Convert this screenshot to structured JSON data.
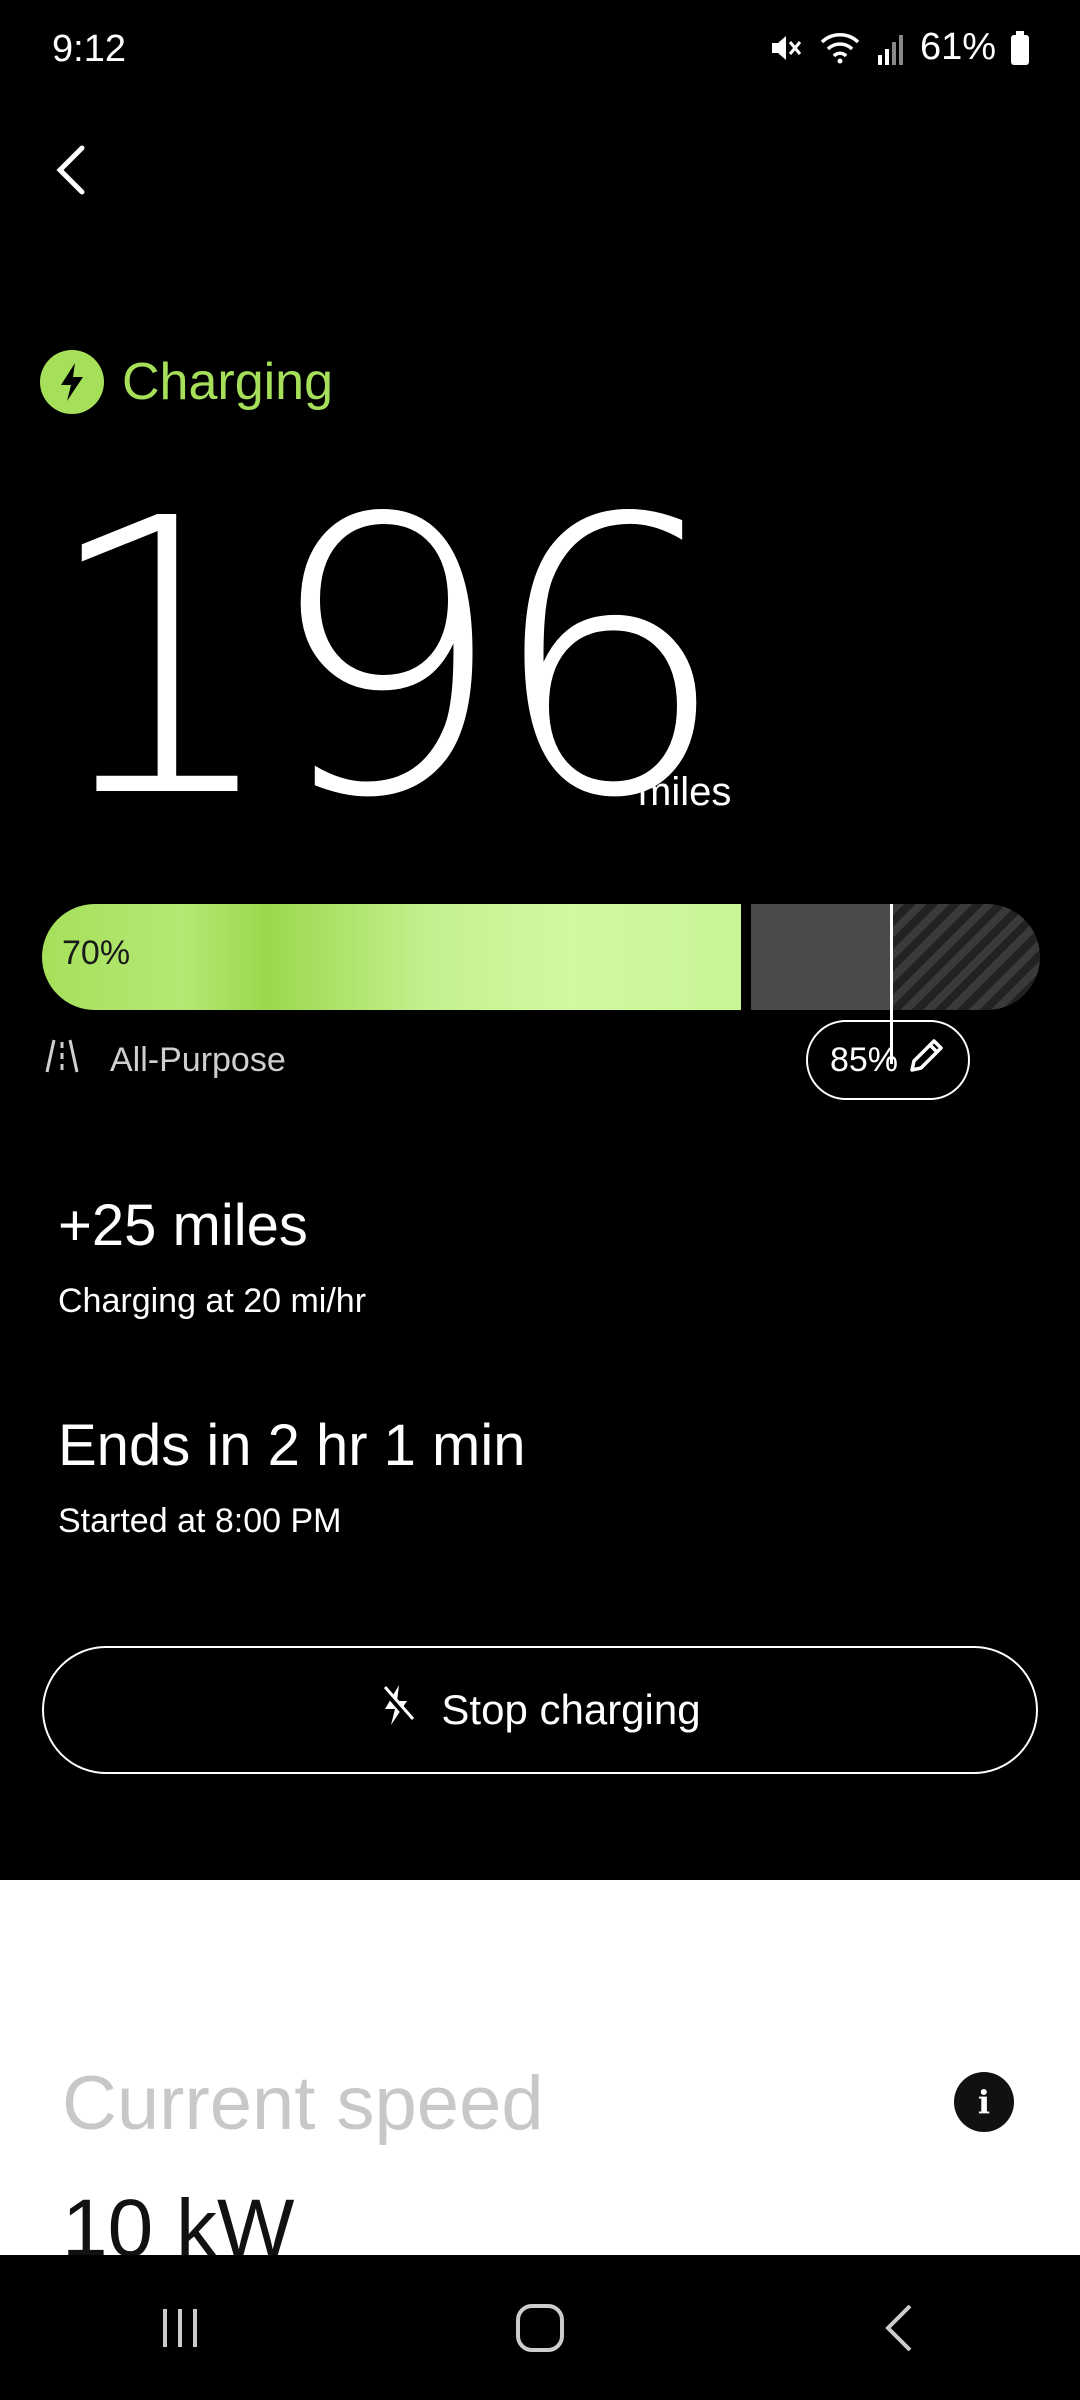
{
  "status_bar": {
    "time": "9:12",
    "battery": "61%",
    "icons": [
      "mute-icon",
      "wifi-icon",
      "signal-icon",
      "battery-icon"
    ]
  },
  "charging": {
    "status": "Charging",
    "range_value": "196",
    "range_unit": "miles",
    "battery_percent_label": "70%",
    "battery_level": 0.7,
    "charge_limit": 0.85,
    "charge_limit_label": "85%",
    "mode_label": "All-Purpose",
    "added": "+25 miles",
    "rate": "Charging at 20 mi/hr",
    "ends": "Ends in 2 hr 1 min",
    "started": "Started at 8:00 PM",
    "stop_button": "Stop charging"
  },
  "panel": {
    "speed_title": "Current speed",
    "speed_value": "10 kW"
  },
  "colors": {
    "accent_green": "#a6e05a",
    "background": "#000000",
    "panel": "#ffffff"
  }
}
